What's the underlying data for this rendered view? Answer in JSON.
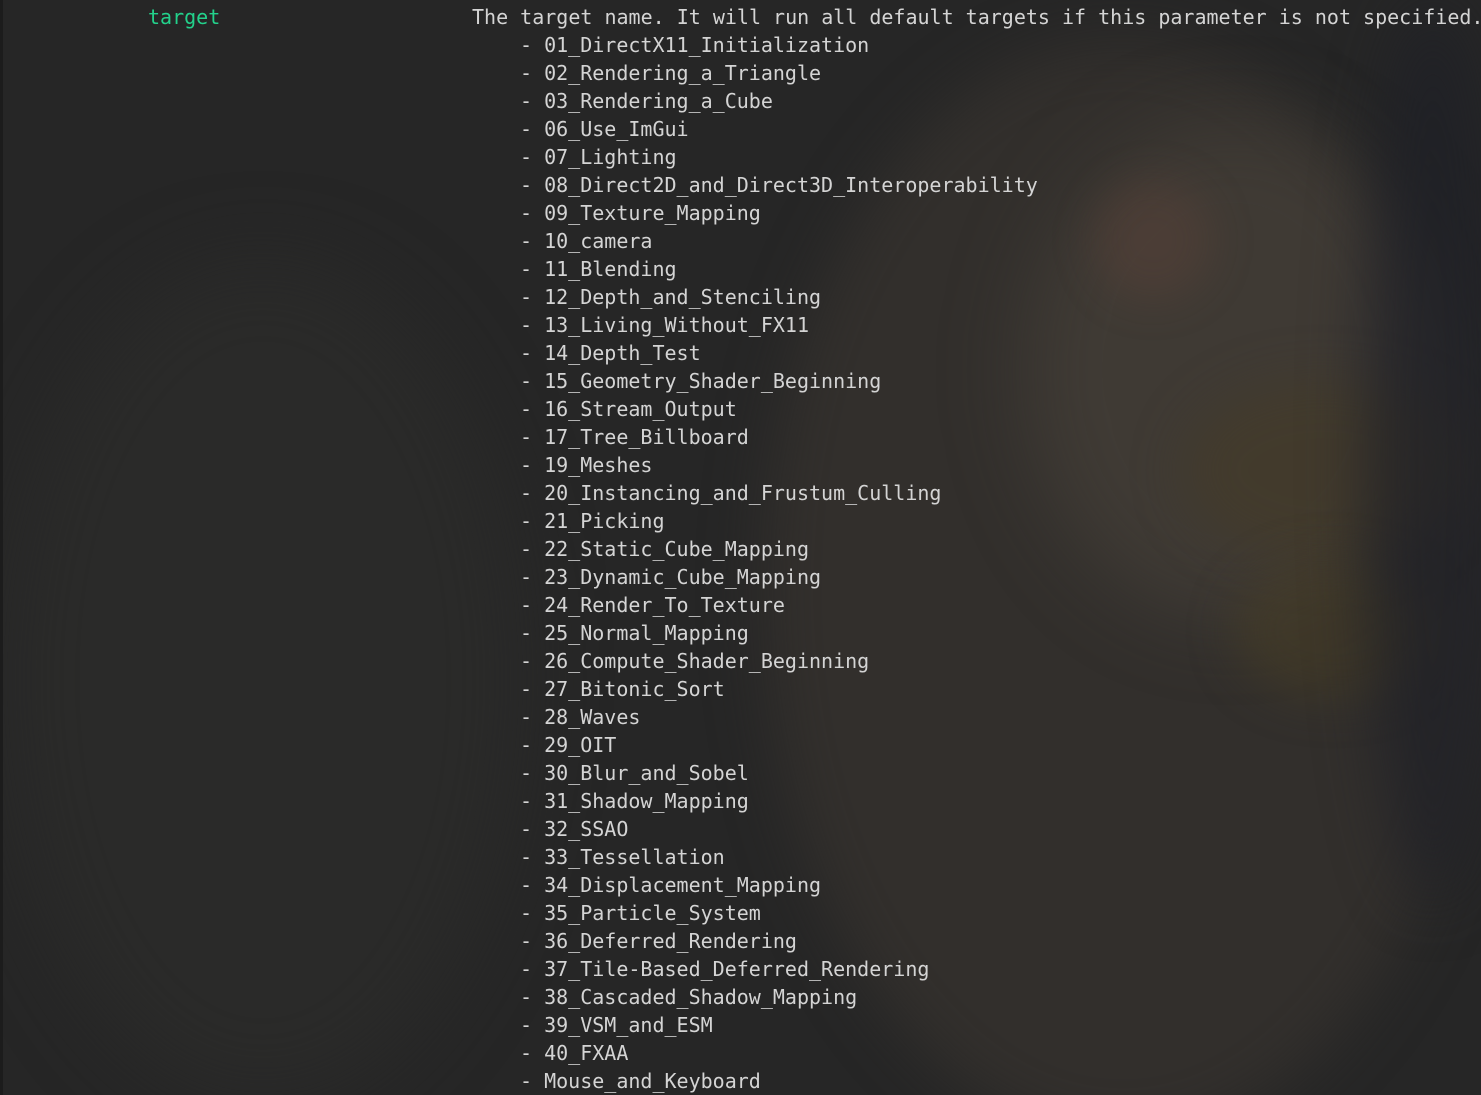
{
  "param_name": "target",
  "description": "The target name. It will run all default targets if this parameter is not specified.",
  "bullet": "- ",
  "targets": [
    "01_DirectX11_Initialization",
    "02_Rendering_a_Triangle",
    "03_Rendering_a_Cube",
    "06_Use_ImGui",
    "07_Lighting",
    "08_Direct2D_and_Direct3D_Interoperability",
    "09_Texture_Mapping",
    "10_camera",
    "11_Blending",
    "12_Depth_and_Stenciling",
    "13_Living_Without_FX11",
    "14_Depth_Test",
    "15_Geometry_Shader_Beginning",
    "16_Stream_Output",
    "17_Tree_Billboard",
    "19_Meshes",
    "20_Instancing_and_Frustum_Culling",
    "21_Picking",
    "22_Static_Cube_Mapping",
    "23_Dynamic_Cube_Mapping",
    "24_Render_To_Texture",
    "25_Normal_Mapping",
    "26_Compute_Shader_Beginning",
    "27_Bitonic_Sort",
    "28_Waves",
    "29_OIT",
    "30_Blur_and_Sobel",
    "31_Shadow_Mapping",
    "32_SSAO",
    "33_Tessellation",
    "34_Displacement_Mapping",
    "35_Particle_System",
    "36_Deferred_Rendering",
    "37_Tile-Based_Deferred_Rendering",
    "38_Cascaded_Shadow_Mapping",
    "39_VSM_and_ESM",
    "40_FXAA",
    "Mouse_and_Keyboard"
  ],
  "colors": {
    "background": "#262626",
    "param": "#23d18b",
    "text": "#d4d4d4"
  }
}
